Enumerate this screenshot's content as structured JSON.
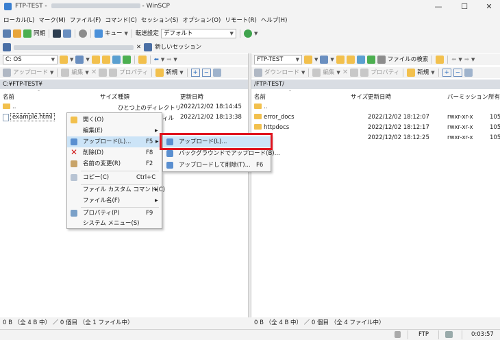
{
  "window": {
    "title_prefix": "FTP-TEST - ",
    "title_suffix": "- WinSCP",
    "min_glyph": "—",
    "max_glyph": "☐",
    "close_glyph": "✕"
  },
  "menubar": [
    "ローカル(L)",
    "マーク(M)",
    "ファイル(F)",
    "コマンド(C)",
    "セッション(S)",
    "オプション(O)",
    "リモート(R)",
    "ヘルプ(H)"
  ],
  "toolbar": {
    "sync_label": "同期",
    "queue_label": "キュー",
    "transfer_settings_label": "転送設定",
    "transfer_preset": "デフォルト"
  },
  "sessions": {
    "close_glyph": "✕",
    "new_session_label": "新しいセッション"
  },
  "left_panel": {
    "drive": "C: OS",
    "upload_label": "アップロード",
    "edit_label": "編集",
    "properties_label": "プロパティ",
    "new_label": "新規",
    "path": "C:¥FTP-TEST¥",
    "columns": [
      "名前",
      "サイズ",
      "種類",
      "更新日時"
    ],
    "rows": [
      {
        "name": "..",
        "size": "",
        "type": "ひとつ上のディレクトリ",
        "modified": "2022/12/02  18:14:45"
      },
      {
        "name": "example.html",
        "size": "",
        "type": "ィル",
        "modified": "2022/12/02  18:13:38"
      }
    ],
    "status": "0 B （全 4 B 中） ／ 0 個目 （全 1 ファイル中）"
  },
  "right_panel": {
    "site": "FTP-TEST",
    "find_files_label": "ファイルの検索",
    "download_label": "ダウンロード",
    "edit_label": "編集",
    "properties_label": "プロパティ",
    "new_label": "新規",
    "path": "/FTP-TEST/",
    "columns": [
      "名前",
      "サイズ",
      "更新日時",
      "パーミッション",
      "所有"
    ],
    "rows": [
      {
        "name": "..",
        "modified": "",
        "perm": "",
        "owner": ""
      },
      {
        "name": "error_docs",
        "modified": "2022/12/02  18:12:07",
        "perm": "rwxr-xr-x",
        "owner": "105"
      },
      {
        "name": "httpdocs",
        "modified": "2022/12/02  18:12:17",
        "perm": "rwxr-xr-x",
        "owner": "105"
      },
      {
        "name": "",
        "modified": "2022/12/02  18:12:25",
        "perm": "rwxr-xr-x",
        "owner": "105"
      }
    ],
    "status": "0 B （全 4 B 中） ／ 0 個目 （全 4 ファイル中）"
  },
  "context_menu": {
    "items": [
      {
        "label": "開く(O)",
        "shortcut": ""
      },
      {
        "label": "編集(E)",
        "shortcut": ""
      },
      {
        "label": "アップロード(L)...",
        "shortcut": "F5"
      },
      {
        "label": "削除(D)",
        "shortcut": "F8"
      },
      {
        "label": "名前の変更(R)",
        "shortcut": "F2"
      },
      {
        "label": "コピー(C)",
        "shortcut": "Ctrl+C"
      },
      {
        "label": "ファイル カスタム コマンド(C)",
        "shortcut": ""
      },
      {
        "label": "ファイル名(F)",
        "shortcut": ""
      },
      {
        "label": "プロパティ(P)",
        "shortcut": "F9"
      },
      {
        "label": "システム メニュー(S)",
        "shortcut": ""
      }
    ]
  },
  "submenu": {
    "items": [
      {
        "label": "アップロード(L)...",
        "shortcut": ""
      },
      {
        "label": "バックグラウンドでアップロード(B)...",
        "shortcut": ""
      },
      {
        "label": "アップロードして削除(T)...",
        "shortcut": "F6"
      }
    ]
  },
  "bottombar": {
    "protocol": "FTP",
    "elapsed": "0:03:57"
  },
  "colors": {
    "highlight_border": "#e0141e",
    "menu_highlight": "#cce4f7",
    "folder": "#f2c04d",
    "path_bar": "#d9dde3"
  }
}
